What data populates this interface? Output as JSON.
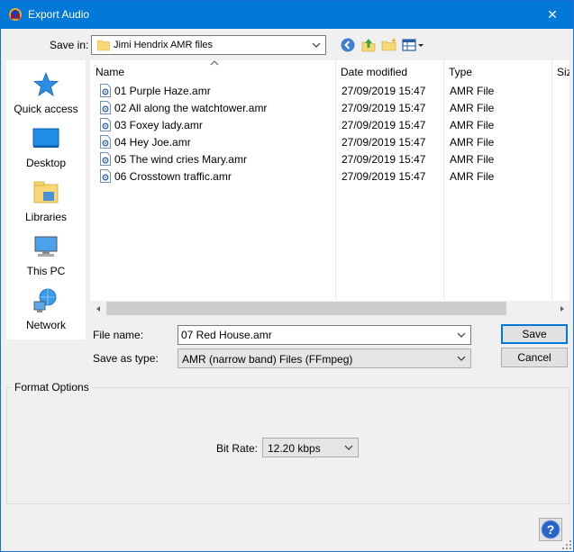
{
  "window": {
    "title": "Export Audio",
    "close_glyph": "✕"
  },
  "save_in": {
    "label": "Save in:",
    "value": "Jimi Hendrix AMR files"
  },
  "toolbar_icons": [
    "back-icon",
    "up-folder-icon",
    "new-folder-icon",
    "view-menu-icon"
  ],
  "places": [
    {
      "label": "Quick access",
      "icon": "star-icon"
    },
    {
      "label": "Desktop",
      "icon": "desktop-icon"
    },
    {
      "label": "Libraries",
      "icon": "libraries-icon"
    },
    {
      "label": "This PC",
      "icon": "computer-icon"
    },
    {
      "label": "Network",
      "icon": "network-icon"
    }
  ],
  "columns": [
    "Name",
    "Date modified",
    "Type",
    "Siz"
  ],
  "files": [
    {
      "name": "01 Purple Haze.amr",
      "date": "27/09/2019 15:47",
      "type": "AMR File"
    },
    {
      "name": "02 All along the watchtower.amr",
      "date": "27/09/2019 15:47",
      "type": "AMR File"
    },
    {
      "name": "03 Foxey lady.amr",
      "date": "27/09/2019 15:47",
      "type": "AMR File"
    },
    {
      "name": "04 Hey Joe.amr",
      "date": "27/09/2019 15:47",
      "type": "AMR File"
    },
    {
      "name": "05 The wind cries Mary.amr",
      "date": "27/09/2019 15:47",
      "type": "AMR File"
    },
    {
      "name": "06 Crosstown traffic.amr",
      "date": "27/09/2019 15:47",
      "type": "AMR File"
    }
  ],
  "file_name": {
    "label": "File name:",
    "value": "07 Red House.amr"
  },
  "save_as_type": {
    "label": "Save as type:",
    "value": "AMR (narrow band) Files (FFmpeg)"
  },
  "buttons": {
    "save": "Save",
    "cancel": "Cancel"
  },
  "format_options": {
    "title": "Format Options",
    "bit_rate_label": "Bit Rate:",
    "bit_rate_value": "12.20 kbps"
  },
  "colors": {
    "titlebar": "#0078d7",
    "accent": "#0078d7"
  }
}
